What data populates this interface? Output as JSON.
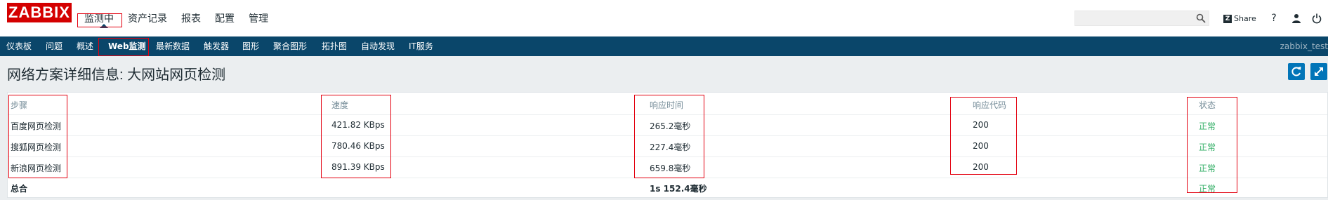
{
  "header": {
    "logo_text": "ZABBIX",
    "main_menu": [
      "监测中",
      "资产记录",
      "报表",
      "配置",
      "管理"
    ],
    "search": {
      "value": "",
      "placeholder": ""
    },
    "share_label": "Share",
    "help_symbol": "?",
    "icons": [
      "search-icon",
      "share-icon",
      "help-icon",
      "user-icon",
      "power-icon"
    ]
  },
  "subnav": {
    "items": [
      "仪表板",
      "问题",
      "概述",
      "Web监测",
      "最新数据",
      "触发器",
      "图形",
      "聚合图形",
      "拓扑图",
      "自动发现",
      "IT服务"
    ],
    "active": "Web监测",
    "user": "zabbix_test"
  },
  "page": {
    "title": "网络方案详细信息: 大网站网页检测",
    "buttons": [
      "refresh-icon",
      "fullscreen-icon"
    ]
  },
  "table": {
    "columns": [
      "步骤",
      "速度",
      "响应时间",
      "响应代码",
      "状态"
    ],
    "rows": [
      {
        "step": "百度网页检测",
        "speed": "421.82 KBps",
        "response_time": "265.2毫秒",
        "code": "200",
        "status": "正常"
      },
      {
        "step": "搜狐网页检测",
        "speed": "780.46 KBps",
        "response_time": "227.4毫秒",
        "code": "200",
        "status": "正常"
      },
      {
        "step": "新浪网页检测",
        "speed": "891.39 KBps",
        "response_time": "659.8毫秒",
        "code": "200",
        "status": "正常"
      }
    ],
    "total": {
      "label": "总合",
      "response_time": "1s 152.4毫秒",
      "status": "正常"
    }
  },
  "colors": {
    "logo_bg": "#d40000",
    "nav_bg": "#0a466a",
    "page_bg": "#ebeef0",
    "ok_text": "#34af67",
    "button_blue": "#0275b8",
    "annotation_red": "#e3000f"
  }
}
